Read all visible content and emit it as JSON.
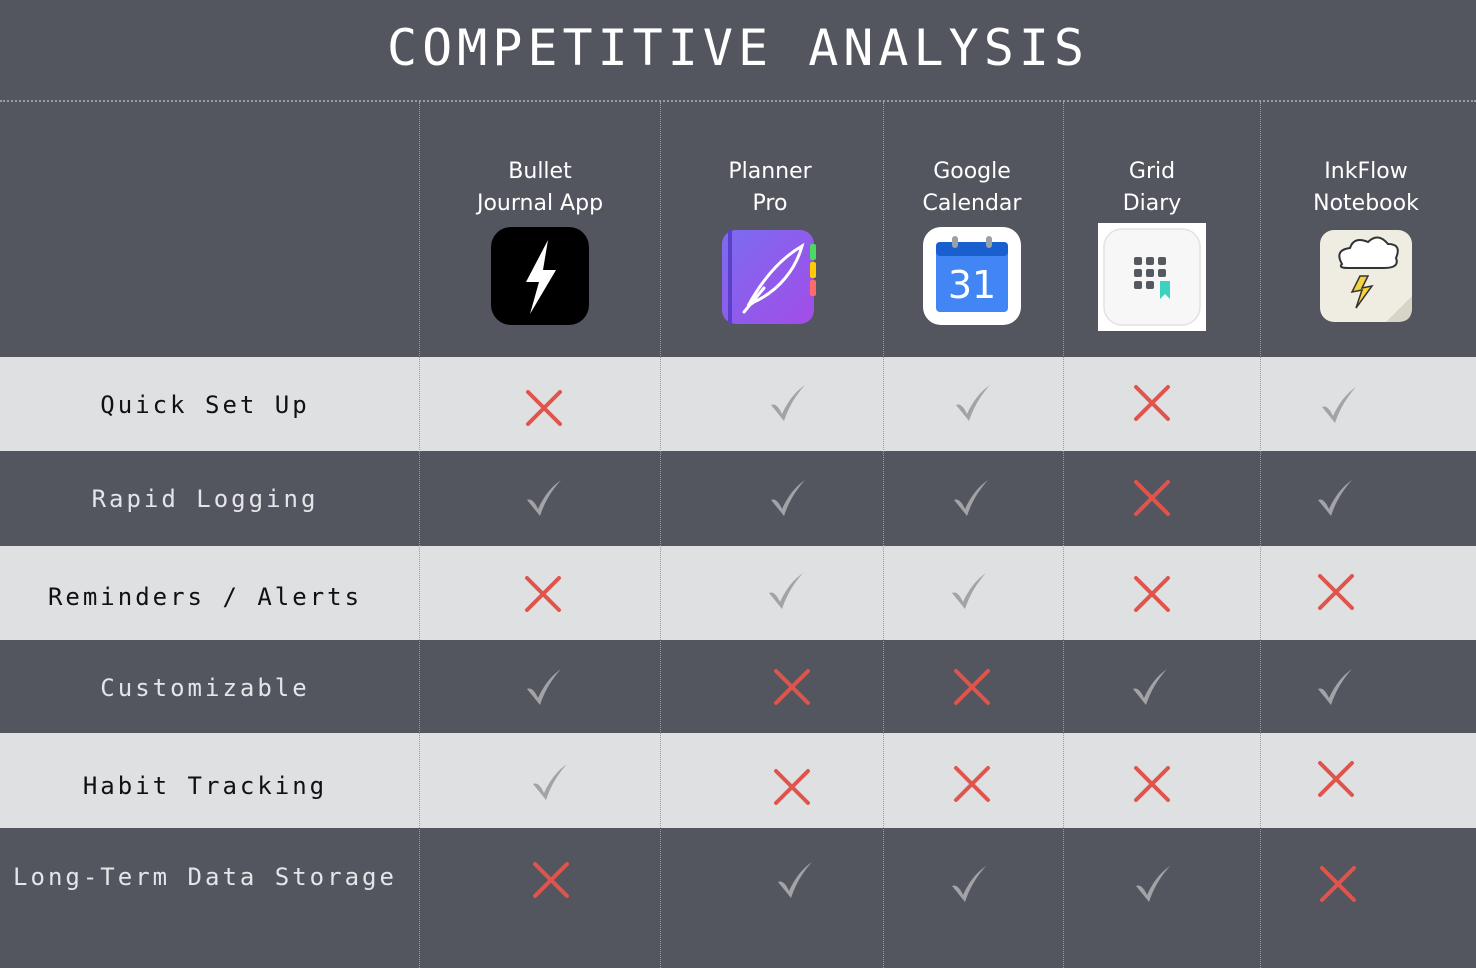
{
  "title": "COMPETITIVE ANALYSIS",
  "colors": {
    "background_dark": "#53565e",
    "row_light": "#dfe0e2",
    "check": "#a2a3a6",
    "cross": "#e0544c"
  },
  "apps": [
    {
      "name": "Bullet\nJournal App",
      "icon": "bullet-journal-icon"
    },
    {
      "name": "Planner\nPro",
      "icon": "planner-pro-icon"
    },
    {
      "name": "Google\nCalendar",
      "icon": "google-calendar-icon",
      "icon_text": "31"
    },
    {
      "name": "Grid\nDiary",
      "icon": "grid-diary-icon"
    },
    {
      "name": "InkFlow\nNotebook",
      "icon": "inkflow-notebook-icon"
    }
  ],
  "features": [
    {
      "label": "Quick Set Up",
      "values": [
        "cross",
        "check",
        "check",
        "cross",
        "check"
      ]
    },
    {
      "label": "Rapid Logging",
      "values": [
        "check",
        "check",
        "check",
        "cross",
        "check"
      ]
    },
    {
      "label": "Reminders / Alerts",
      "values": [
        "cross",
        "check",
        "check",
        "cross",
        "cross"
      ]
    },
    {
      "label": "Customizable",
      "values": [
        "check",
        "cross",
        "cross",
        "check",
        "check"
      ]
    },
    {
      "label": "Habit Tracking",
      "values": [
        "check",
        "cross",
        "cross",
        "cross",
        "cross"
      ]
    },
    {
      "label": "Long-Term Data Storage",
      "values": [
        "cross",
        "check",
        "check",
        "check",
        "cross"
      ]
    }
  ]
}
